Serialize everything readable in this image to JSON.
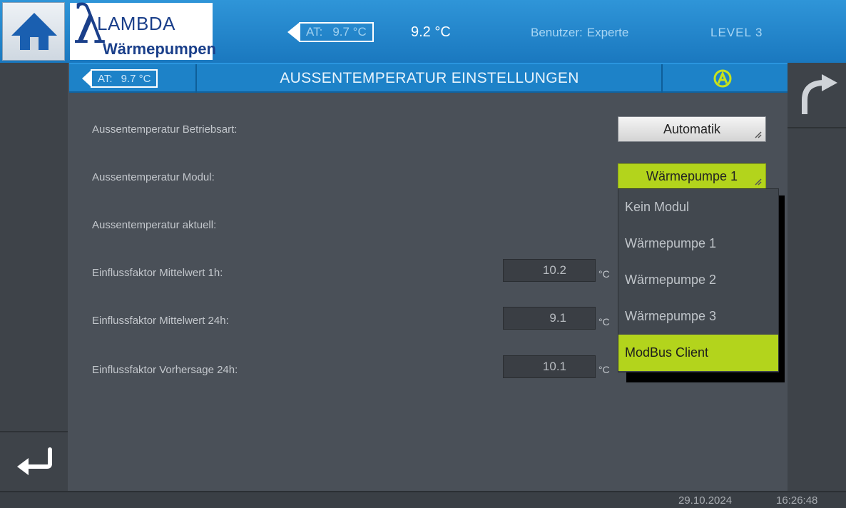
{
  "header": {
    "logo_line1": "LAMBDA",
    "logo_line2": "Wärmepumpen",
    "at_label": "AT:",
    "at_value": "9.7 °C",
    "current_temp": "9.2 °C",
    "user_label": "Benutzer:",
    "user_value": "Experte",
    "level": "LEVEL  3"
  },
  "title_bar": {
    "at_label": "AT:",
    "at_value": "9.7 °C",
    "title": "AUSSENTEMPERATUR EINSTELLUNGEN",
    "mode_icon": "auto-mode-icon"
  },
  "rows": {
    "betriebsart_label": "Aussentemperatur Betriebsart:",
    "betriebsart_value": "Automatik",
    "modul_label": "Aussentemperatur Modul:",
    "modul_value": "Wärmepumpe 1",
    "aktuell_label": "Aussentemperatur aktuell:",
    "mittel1h_label": "Einflussfaktor Mittelwert 1h:",
    "mittel1h_value": "10.2",
    "mittel24h_label": "Einflussfaktor Mittelwert 24h:",
    "mittel24h_value": "9.1",
    "vorhersage_label": "Einflussfaktor Vorhersage 24h:",
    "vorhersage_value": "10.1",
    "unit": "°C"
  },
  "dropdown": {
    "options": [
      "Kein Modul",
      "Wärmepumpe 1",
      "Wärmepumpe 2",
      "Wärmepumpe 3",
      "ModBus Client"
    ],
    "selected_index": 4
  },
  "footer": {
    "date": "29.10.2024",
    "time": "16:26:48"
  },
  "colors": {
    "header_blue": "#1d82c8",
    "accent_green": "#b3d41c",
    "background": "#4a5058"
  }
}
